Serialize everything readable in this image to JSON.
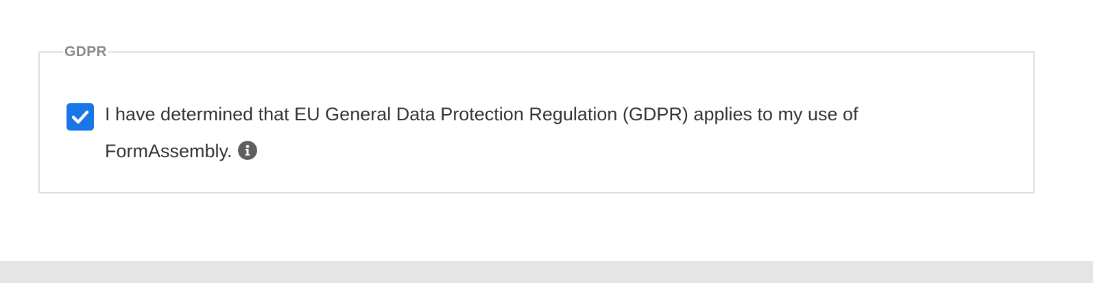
{
  "gdpr": {
    "legend": "GDPR",
    "checkbox_checked": true,
    "label_text": "I have determined that EU General Data Protection Regulation (GDPR) applies to my use of FormAssembly.",
    "info_icon": "info-icon"
  },
  "colors": {
    "checkbox": "#1976e8",
    "border": "#dcdde6",
    "legend": "#8a8a8a",
    "text": "#333333",
    "info_icon": "#5f5f5f",
    "footer_band": "#e5e5e5"
  }
}
